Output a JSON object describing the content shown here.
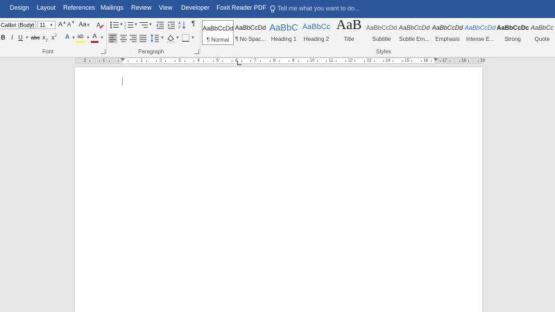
{
  "tabs": [
    {
      "label": "Design"
    },
    {
      "label": "Layout"
    },
    {
      "label": "References"
    },
    {
      "label": "Mailings"
    },
    {
      "label": "Review"
    },
    {
      "label": "View"
    },
    {
      "label": "Developer"
    },
    {
      "label": "Foxit Reader PDF"
    }
  ],
  "tell_me": "Tell me what you want to do...",
  "font": {
    "family": "Calibri (Body)",
    "size": "11",
    "group_label": "Font",
    "grow": "A",
    "shrink": "A",
    "change_case": "Aa",
    "bold": "B",
    "italic": "I",
    "underline": "U",
    "strikethrough": "abc",
    "subscript": "x",
    "superscript": "x",
    "text_effects": "A",
    "highlight": "ab",
    "font_color": "A"
  },
  "paragraph": {
    "group_label": "Paragraph",
    "show_marks": "¶"
  },
  "styles": {
    "group_label": "Styles",
    "items": [
      {
        "preview": "AaBbCcDd",
        "name": "¶ Normal"
      },
      {
        "preview": "AaBbCcDd",
        "name": "¶ No Spac..."
      },
      {
        "preview": "AaBbC",
        "name": "Heading 1"
      },
      {
        "preview": "AaBbCc",
        "name": "Heading 2"
      },
      {
        "preview": "AaB",
        "name": "Title"
      },
      {
        "preview": "AaBbCcDd",
        "name": "Subtitle"
      },
      {
        "preview": "AaBbCcDd",
        "name": "Subtle Em..."
      },
      {
        "preview": "AaBbCcDd",
        "name": "Emphasis"
      },
      {
        "preview": "AaBbCcDd",
        "name": "Intense E..."
      },
      {
        "preview": "AaBbCcDc",
        "name": "Strong"
      },
      {
        "preview": "AaBbCc",
        "name": "Quote"
      }
    ]
  },
  "ruler": {
    "left_numbers": [
      "2",
      "1"
    ],
    "right_numbers": [
      "1",
      "2",
      "3",
      "4",
      "5",
      "6",
      "7",
      "8",
      "9",
      "10",
      "11",
      "12",
      "13",
      "14",
      "15",
      "16",
      "17",
      "18",
      "19"
    ]
  },
  "colors": {
    "tabbar": "#2b579a",
    "highlight_bar": "#ffff00",
    "font_color_bar": "#e02020",
    "heading": "#2e74b5"
  }
}
